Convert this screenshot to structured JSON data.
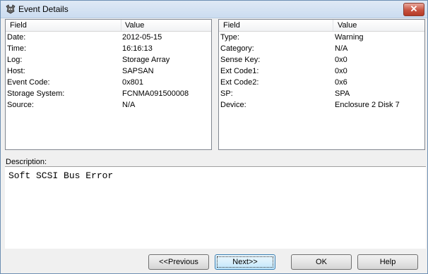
{
  "window": {
    "title": "Event Details",
    "close_glyph": "✕"
  },
  "left_panel": {
    "columns": [
      "Field",
      "Value"
    ],
    "rows": [
      [
        "Date:",
        "2012-05-15"
      ],
      [
        "Time:",
        "16:16:13"
      ],
      [
        "Log:",
        "Storage Array"
      ],
      [
        "Host:",
        "SAPSAN"
      ],
      [
        "Event Code:",
        "0x801"
      ],
      [
        "Storage System:",
        "FCNMA091500008"
      ],
      [
        "Source:",
        "N/A"
      ]
    ]
  },
  "right_panel": {
    "columns": [
      "Field",
      "Value"
    ],
    "rows": [
      [
        "Type:",
        "Warning"
      ],
      [
        "Category:",
        "N/A"
      ],
      [
        "Sense Key:",
        "0x0"
      ],
      [
        "Ext Code1:",
        "0x0"
      ],
      [
        "Ext Code2:",
        "0x6"
      ],
      [
        "SP:",
        "SPA"
      ],
      [
        "Device:",
        "Enclosure 2 Disk 7"
      ]
    ]
  },
  "description": {
    "label": "Description:",
    "text": "Soft SCSI Bus Error"
  },
  "buttons": {
    "previous": "<<Previous",
    "next": "Next>>",
    "ok": "OK",
    "help": "Help"
  }
}
